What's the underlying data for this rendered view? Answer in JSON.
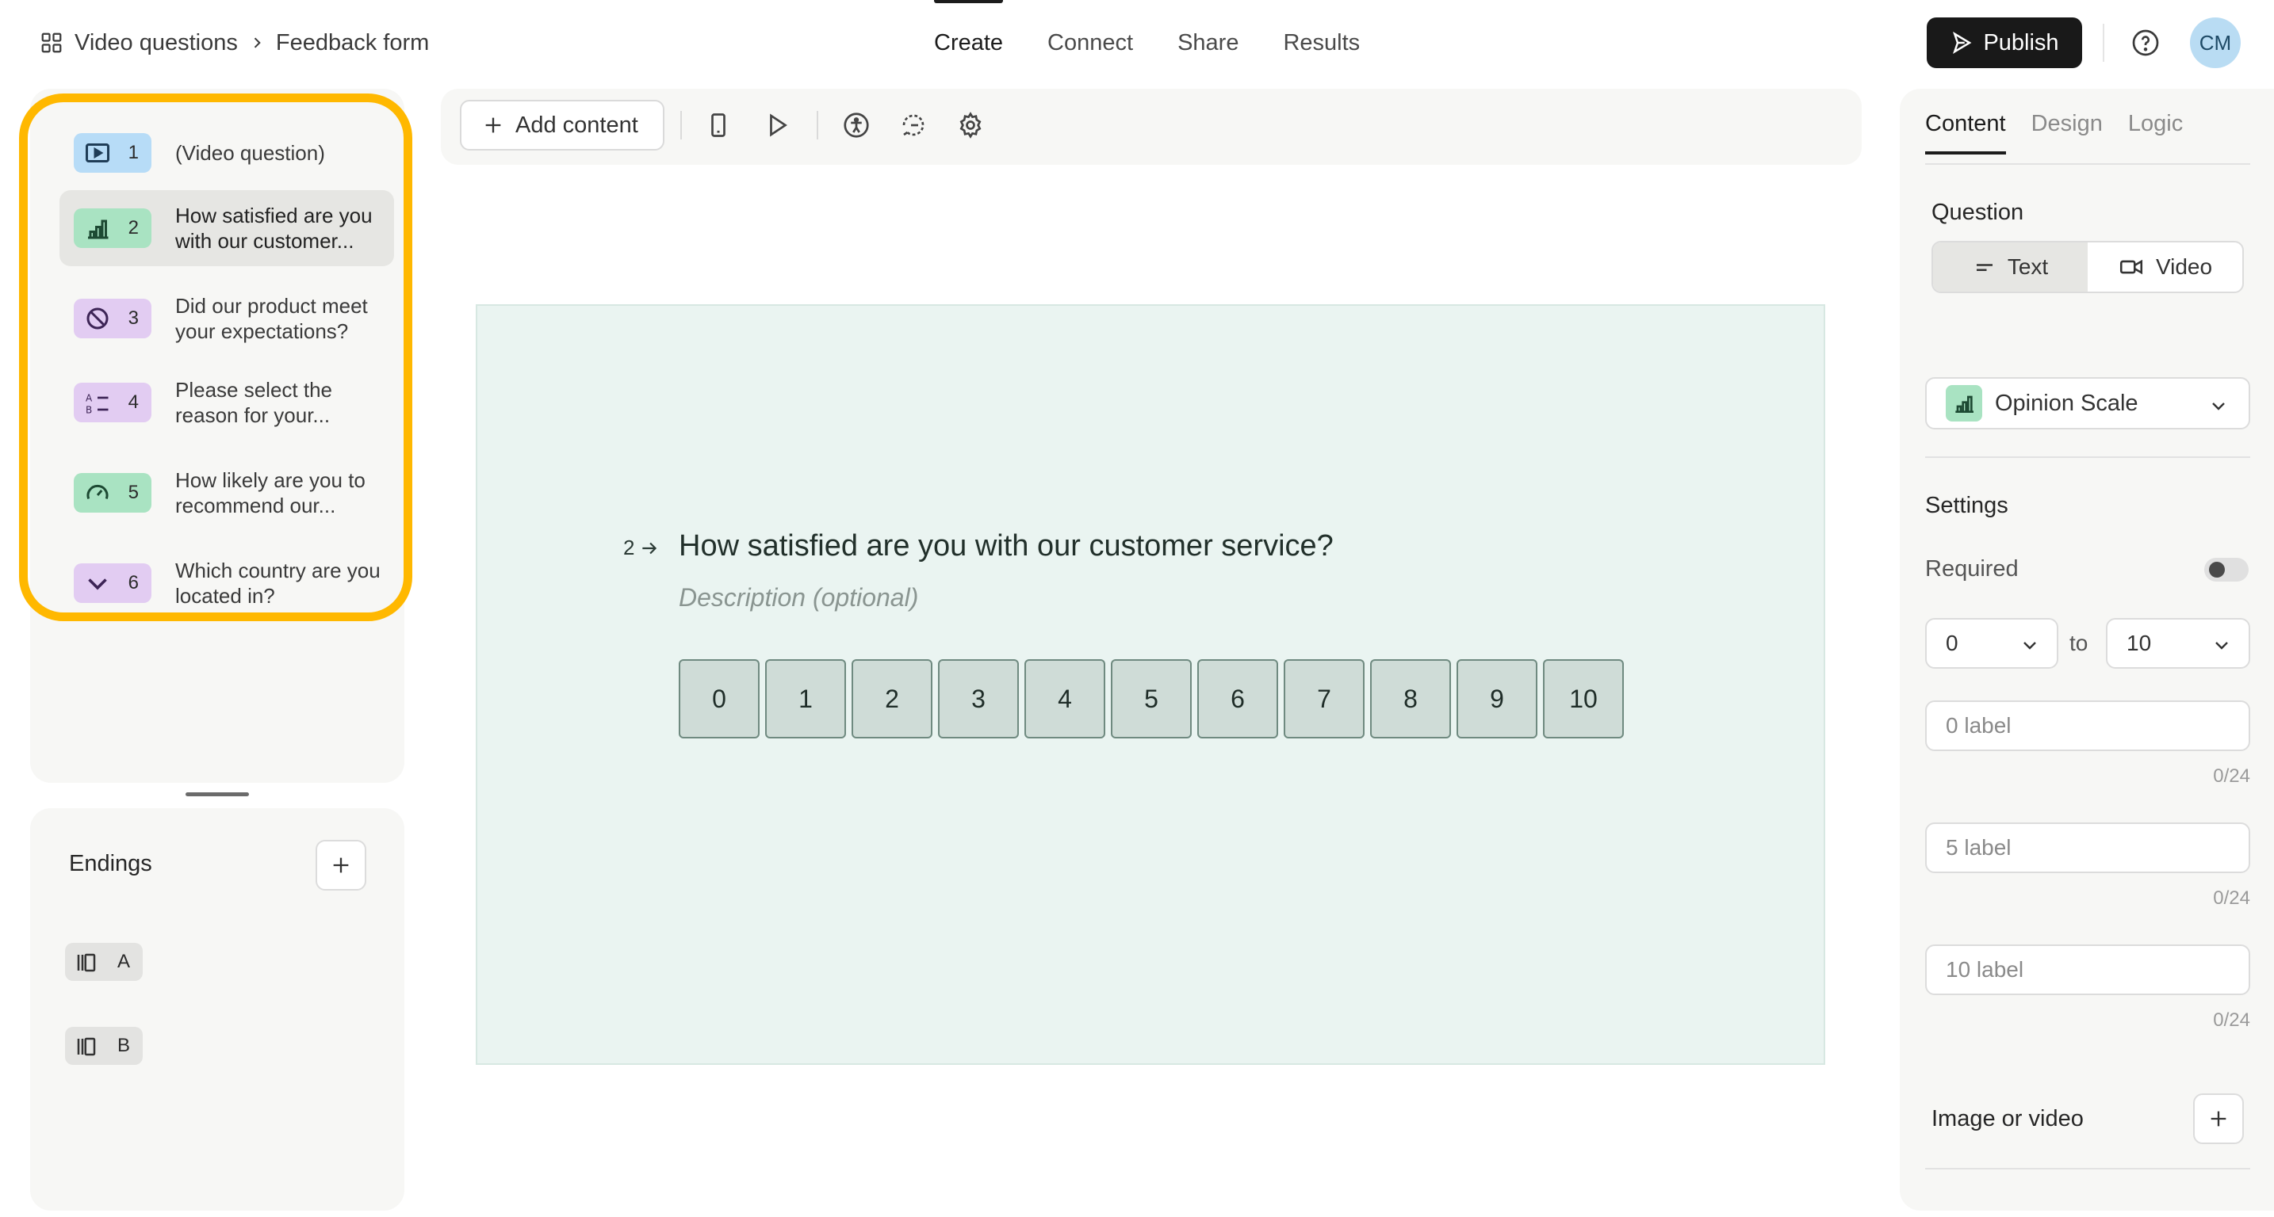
{
  "breadcrumb": {
    "workspace": "Video questions",
    "form": "Feedback form"
  },
  "nav": [
    {
      "label": "Create",
      "active": true
    },
    {
      "label": "Connect",
      "active": false
    },
    {
      "label": "Share",
      "active": false
    },
    {
      "label": "Results",
      "active": false
    }
  ],
  "header": {
    "publish_label": "Publish",
    "avatar_initials": "CM"
  },
  "questions": [
    {
      "number": "1",
      "text": "(Video question)",
      "icon": "video-icon",
      "color": "#b7dcf7"
    },
    {
      "number": "2",
      "text": "How satisfied are you with our customer...",
      "icon": "bar-chart-icon",
      "color": "#a9e3c2",
      "selected": true
    },
    {
      "number": "3",
      "text": "Did our product meet your expectations?",
      "icon": "yes-no-icon",
      "color": "#e2ccf2"
    },
    {
      "number": "4",
      "text": "Please select the reason for your...",
      "icon": "multiple-choice-icon",
      "color": "#e2ccf2"
    },
    {
      "number": "5",
      "text": "How likely are you to recommend our...",
      "icon": "gauge-icon",
      "color": "#a9e3c2"
    },
    {
      "number": "6",
      "text": "Which country are you located in?",
      "icon": "chevron-down-icon",
      "color": "#e2ccf2"
    }
  ],
  "endings": {
    "title": "Endings",
    "items": [
      {
        "letter": "A"
      },
      {
        "letter": "B"
      }
    ]
  },
  "toolbar": {
    "add_content_label": "Add content"
  },
  "canvas": {
    "question_number": "2",
    "question_title": "How satisfied are you with our customer service?",
    "description_placeholder": "Description (optional)",
    "scale": [
      "0",
      "1",
      "2",
      "3",
      "4",
      "5",
      "6",
      "7",
      "8",
      "9",
      "10"
    ],
    "background_color": "#eaf4f1"
  },
  "panel": {
    "tabs": [
      {
        "label": "Content",
        "active": true
      },
      {
        "label": "Design",
        "active": false
      },
      {
        "label": "Logic",
        "active": false
      }
    ],
    "question_heading": "Question",
    "question_mode": {
      "text_label": "Text",
      "video_label": "Video",
      "selected": "Text"
    },
    "question_type": "Opinion Scale",
    "settings_heading": "Settings",
    "required_label": "Required",
    "required_on": false,
    "range": {
      "from": "0",
      "to_label": "to",
      "to": "10"
    },
    "labels": [
      {
        "placeholder": "0 label",
        "counter": "0/24"
      },
      {
        "placeholder": "5 label",
        "counter": "0/24"
      },
      {
        "placeholder": "10 label",
        "counter": "0/24"
      }
    ],
    "media_label": "Image or video"
  },
  "colors": {
    "highlight": "#ffb800",
    "publish_bg": "#191919",
    "avatar_bg": "#b9dcf3"
  }
}
